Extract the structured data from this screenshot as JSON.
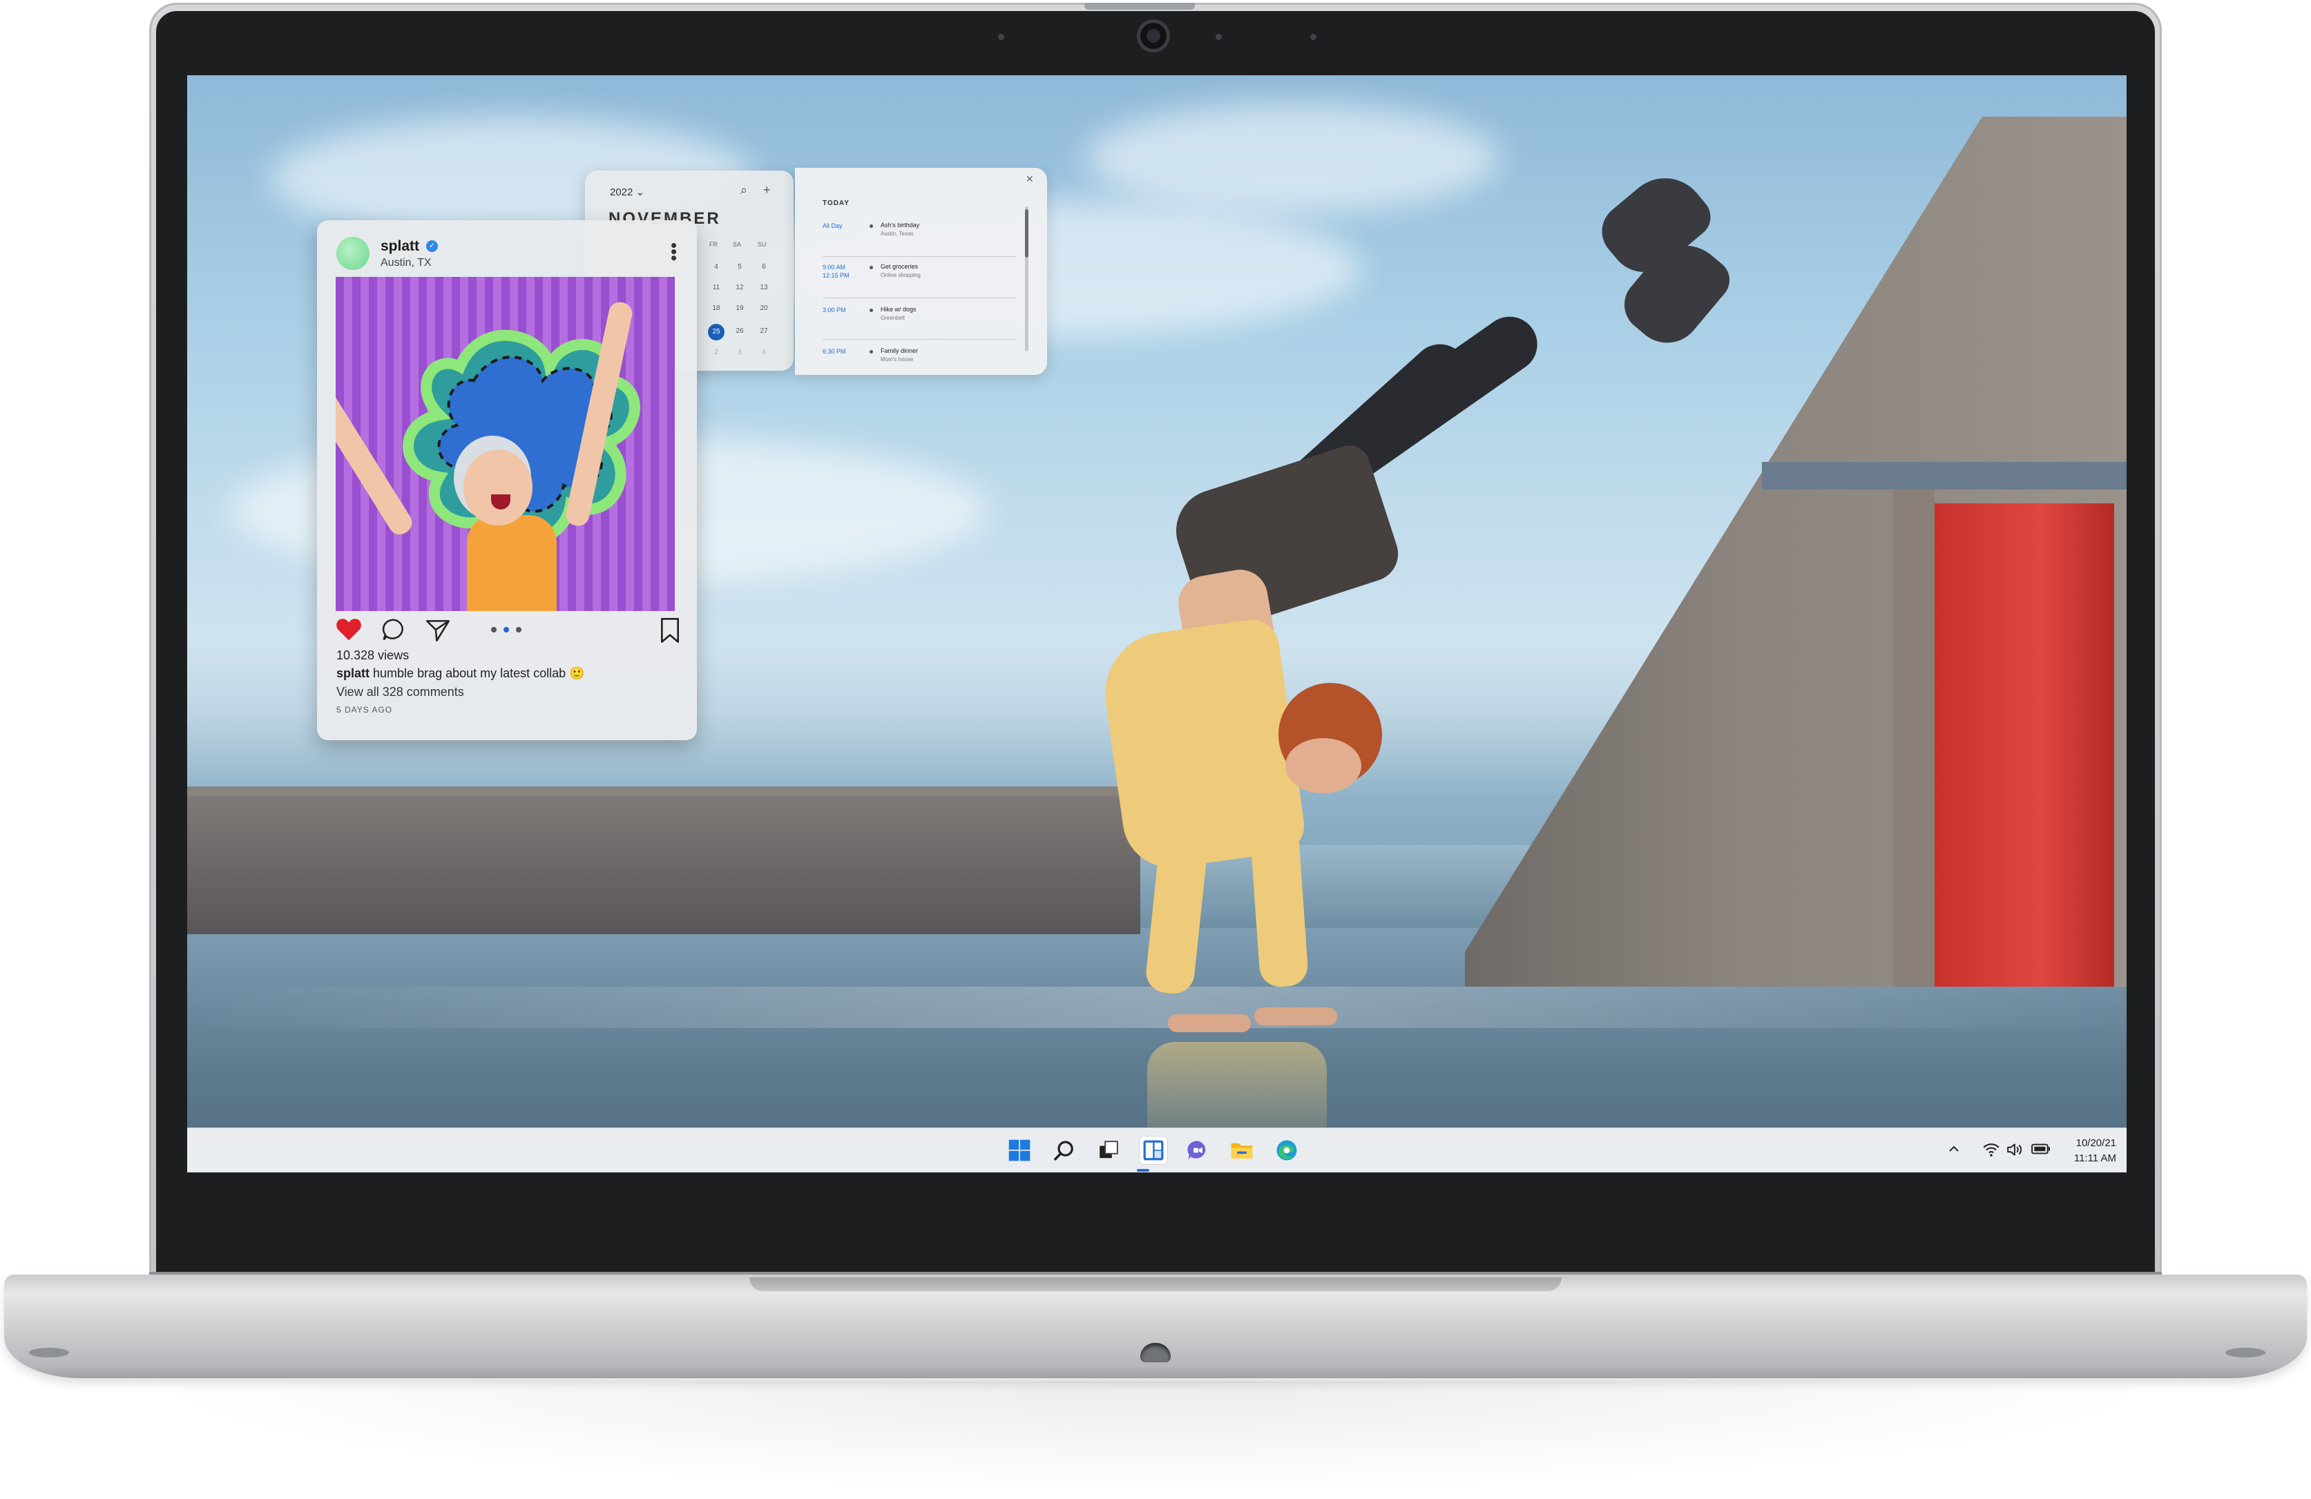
{
  "calendar": {
    "year": "2022",
    "month": "NOVEMBER",
    "weekdays": [
      "FR",
      "SA",
      "SU"
    ],
    "days": [
      [
        "4",
        "5",
        "6"
      ],
      [
        "11",
        "12",
        "13"
      ],
      [
        "18",
        "19",
        "20"
      ],
      [
        "25",
        "26",
        "27"
      ],
      [
        "2",
        "3",
        "4"
      ]
    ],
    "today_day": "25",
    "agenda": {
      "heading": "TODAY",
      "events": [
        {
          "time": "All Day",
          "title": "Ash's birthday",
          "subtitle": "Austin, Texas"
        },
        {
          "time": "9:00 AM\n12:15 PM",
          "title": "Get groceries",
          "subtitle": "Online shopping"
        },
        {
          "time": "3:00 PM",
          "title": "Hike w/ dogs",
          "subtitle": "Greenbelt"
        },
        {
          "time": "6:30 PM",
          "title": "Family dinner",
          "subtitle": "Mom's house"
        }
      ]
    }
  },
  "post": {
    "username": "splatt",
    "location": "Austin, TX",
    "views": "10.328 views",
    "caption_user": "splatt",
    "caption_text": "humble brag about my latest collab",
    "comments_link": "View all 328 comments",
    "age": "5 DAYS AGO"
  },
  "taskbar": {
    "icons": [
      "windows-start-icon",
      "search-icon",
      "task-view-icon",
      "widgets-icon",
      "chat-icon",
      "file-explorer-icon",
      "edge-browser-icon"
    ],
    "clock_date": "10/20/21",
    "clock_time": "11:11 AM"
  },
  "colors": {
    "accent": "#1c5fb8",
    "like_red": "#e0202a",
    "verified_blue": "#2d88e8",
    "taskbar_bg": "#eef1f4"
  }
}
